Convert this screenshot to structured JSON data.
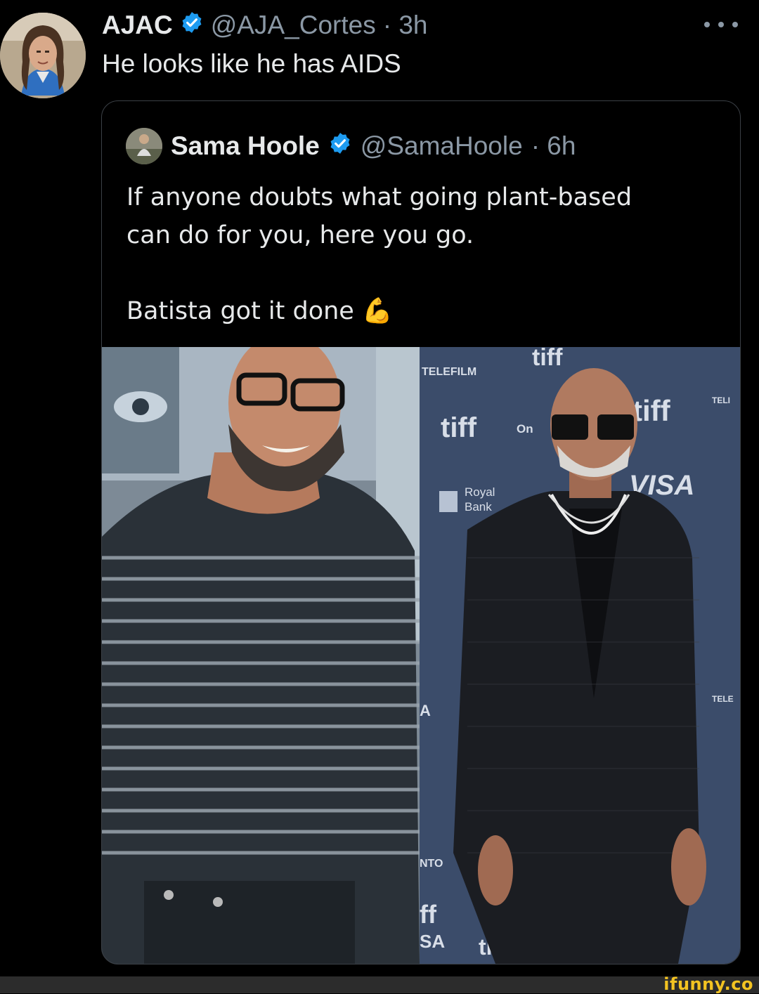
{
  "tweet": {
    "name": "AJAC",
    "handle": "@AJA_Cortes",
    "time": "· 3h",
    "text": "He looks like he has AIDS"
  },
  "quoted": {
    "name": "Sama Hoole",
    "handle": "@SamaHoole",
    "time": "· 6h",
    "line1": "If anyone doubts what going plant-based",
    "line2": "can do for you, here you go.",
    "line3": "Batista got it done",
    "emoji": "💪"
  },
  "photo_signage": {
    "telefilm": "TELEFILM",
    "tiff_top": "tiff",
    "tiff_left": "tiff",
    "tiff_right": "tiff",
    "tiff_bottom_left": "tiff",
    "tiff_bottom_right": "tiff",
    "royal1": "Royal",
    "royal2": "Bank",
    "visa": "VISA",
    "on": "On",
    "sa": "SA",
    "a": "A",
    "nto": "NTO",
    "ff": "ff",
    "tele_r1": "TELI",
    "tele_r2": "TELE"
  },
  "watermark": "ifunny.co",
  "colors": {
    "verified": "#1d9bf0",
    "background": "#000000",
    "muted": "#8b98a5",
    "watermark": "#f3c321"
  }
}
